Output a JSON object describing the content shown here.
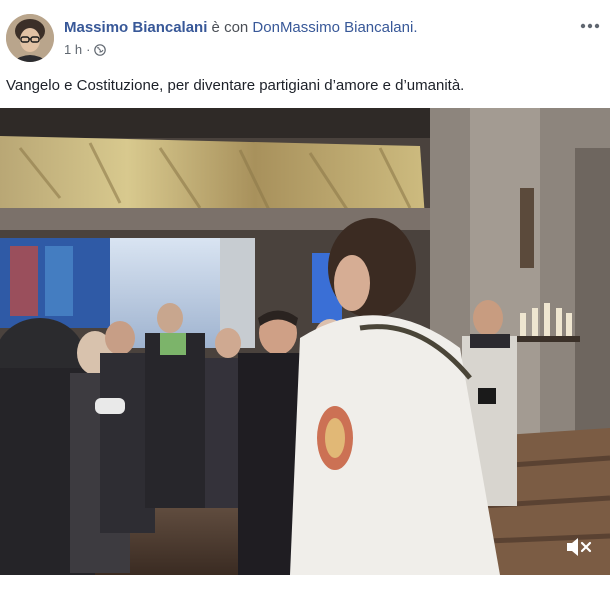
{
  "post": {
    "author": "Massimo Biancalani",
    "with_text": " è con ",
    "tagged": "DonMassimo Biancalani.",
    "time": "1 h",
    "separator": "·",
    "caption": "Vangelo e Costituzione, per diventare partigiani d’amore e d’umanità.",
    "icons": {
      "more": "more-options-icon",
      "audience": "globe-icon",
      "mute": "volume-muted-icon"
    }
  },
  "colors": {
    "link": "#385898",
    "meta": "#606770",
    "text": "#1d2129"
  }
}
